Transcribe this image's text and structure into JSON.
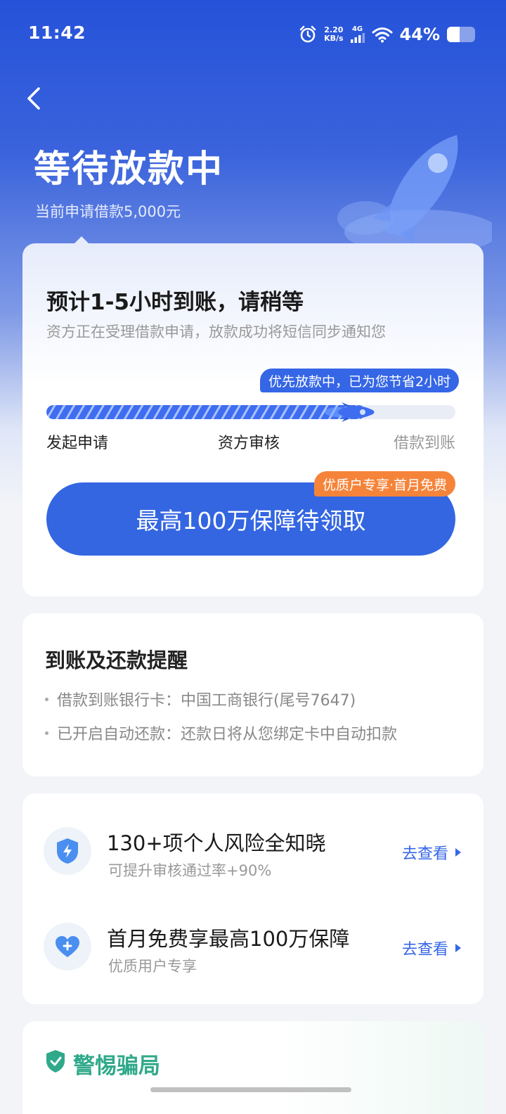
{
  "status_bar": {
    "time": "11:42",
    "net_speed_value": "2.20",
    "net_speed_unit": "KB/s",
    "network_type": "4G",
    "battery_percent": "44%",
    "battery_level": 0.44
  },
  "header": {
    "title": "等待放款中",
    "subtitle": "当前申请借款5,000元"
  },
  "status_card": {
    "title": "预计1-5小时到账，请稍等",
    "description": "资方正在受理借款申请，放款成功将短信同步通知您",
    "priority_tip": "优先放款中，已为您节省2小时",
    "progress": 0.78,
    "steps": [
      "发起申请",
      "资方审核",
      "借款到账"
    ],
    "badge": "优质户专享·首月免费",
    "button_label": "最高100万保障待领取"
  },
  "reminder_card": {
    "title": "到账及还款提醒",
    "items": [
      "借款到账银行卡：中国工商银行(尾号7647)",
      "已开启自动还款：还款日将从您绑定卡中自动扣款"
    ]
  },
  "services": [
    {
      "icon": "shield-icon",
      "title": "130+项个人风险全知晓",
      "desc": "可提升审核通过率+90%",
      "link": "去查看"
    },
    {
      "icon": "heart-plus-icon",
      "title": "首月免费享最高100万保障",
      "desc": "优质用户专享",
      "link": "去查看"
    }
  ],
  "fraud_card": {
    "title": "警惕骗局"
  },
  "colors": {
    "primary": "#3466e2",
    "accent_orange": "#f5843a",
    "fraud_green": "#2fa98a"
  }
}
